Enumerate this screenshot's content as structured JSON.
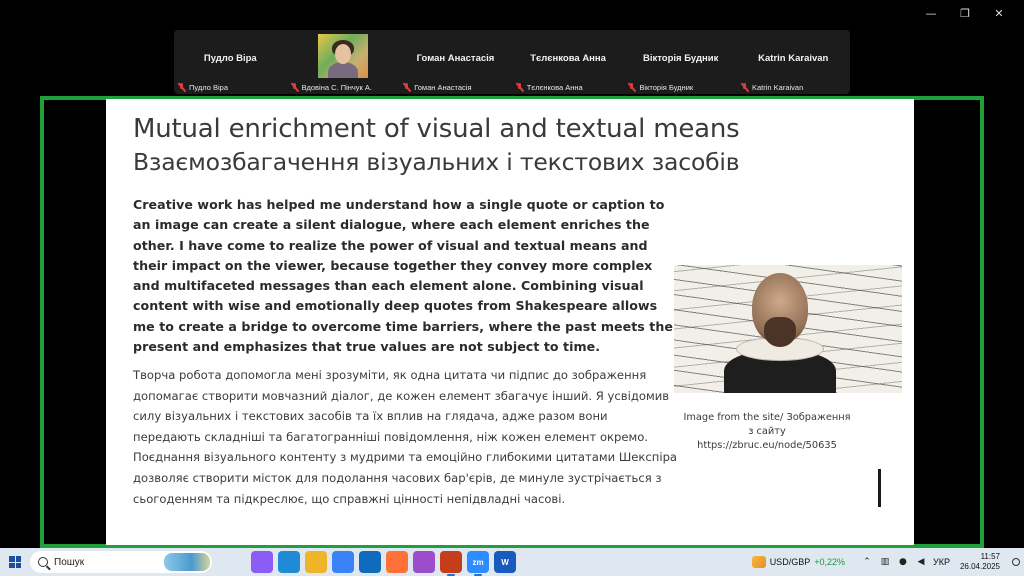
{
  "window": {
    "minimize_glyph": "—",
    "restore_glyph": "❐",
    "close_glyph": "✕"
  },
  "participants": [
    {
      "name": "Пудло Віра",
      "label": "Пудло Віра",
      "has_video": false
    },
    {
      "name": "",
      "label": "Вдовіна С. Пінчук А.",
      "has_video": true
    },
    {
      "name": "Гоман Анастасія",
      "label": "Гоман Анастасія",
      "has_video": false
    },
    {
      "name": "Тєлєнкова Анна",
      "label": "Тєлєнкова Анна",
      "has_video": false
    },
    {
      "name": "Вікторія Будник",
      "label": "Вікторія Будник",
      "has_video": false
    },
    {
      "name": "Katrin Karaivan",
      "label": "Katrin Karaivan",
      "has_video": false
    }
  ],
  "slide": {
    "title": "Mutual enrichment of visual and textual means",
    "subtitle": "Взаємозбагачення візуальних і текстових засобів",
    "paragraph_en": "Creative work has helped me understand how a single quote or caption to an image can create a silent dialogue, where each element enriches the other. I have come to realize the power of visual and textual means and their impact on the viewer, because together they convey more complex and multifaceted messages than each element alone. Combining visual content with wise and emotionally deep quotes from Shakespeare allows me to create a bridge to overcome time barriers, where the past meets the present and emphasizes that true values are not subject to time.",
    "paragraph_uk": "Творча робота допомогла мені зрозуміти, як одна цитата чи підпис до зображення допомагає створити мовчазний діалог, де кожен елемент збагачує інший. Я усвідомив силу візуальних і текстових засобів та їх вплив на глядача, адже разом вони передають складніші та багатогранніші повідомлення, ніж кожен елемент окремо. Поєднання візуального контенту з мудрими та емоційно глибокими цитатами Шекспіра дозволяє створити місток для подолання часових бар'єрів, де минуле зустрічається з сьогоденням та підкреслює, що справжні цінності непідвладні часові.",
    "caption_line1": "Image from the site/ Зображення",
    "caption_line2": "з сайту",
    "caption_line3": "https://zbruc.eu/node/50635"
  },
  "taskbar": {
    "search_placeholder": "Пошук",
    "apps": [
      {
        "icon": "task-view-icon",
        "label": "",
        "color": "#dfe7f1"
      },
      {
        "icon": "copilot-icon",
        "label": "",
        "color": "#8b5cf6"
      },
      {
        "icon": "edge-icon",
        "label": "",
        "color": "#1f8ad6"
      },
      {
        "icon": "file-explorer-icon",
        "label": "",
        "color": "#f0b429"
      },
      {
        "icon": "store-icon",
        "label": "",
        "color": "#3b82f6"
      },
      {
        "icon": "outlook-icon",
        "label": "",
        "color": "#0f6cbd"
      },
      {
        "icon": "firefox-icon",
        "label": "",
        "color": "#ff7139"
      },
      {
        "icon": "maps-icon",
        "label": "",
        "color": "#9b4dca"
      },
      {
        "icon": "powerpoint-icon",
        "label": "",
        "color": "#c43e1c"
      },
      {
        "icon": "zoom-icon",
        "label": "zm",
        "color": "#2d8cff"
      },
      {
        "icon": "word-icon",
        "label": "W",
        "color": "#185abd"
      }
    ],
    "ticker_symbol": "USD/GBP",
    "ticker_change": "+0,22%",
    "chevron_glyph": "⌃",
    "language": "УКР",
    "time": "11:57",
    "date": "26.04.2025"
  }
}
